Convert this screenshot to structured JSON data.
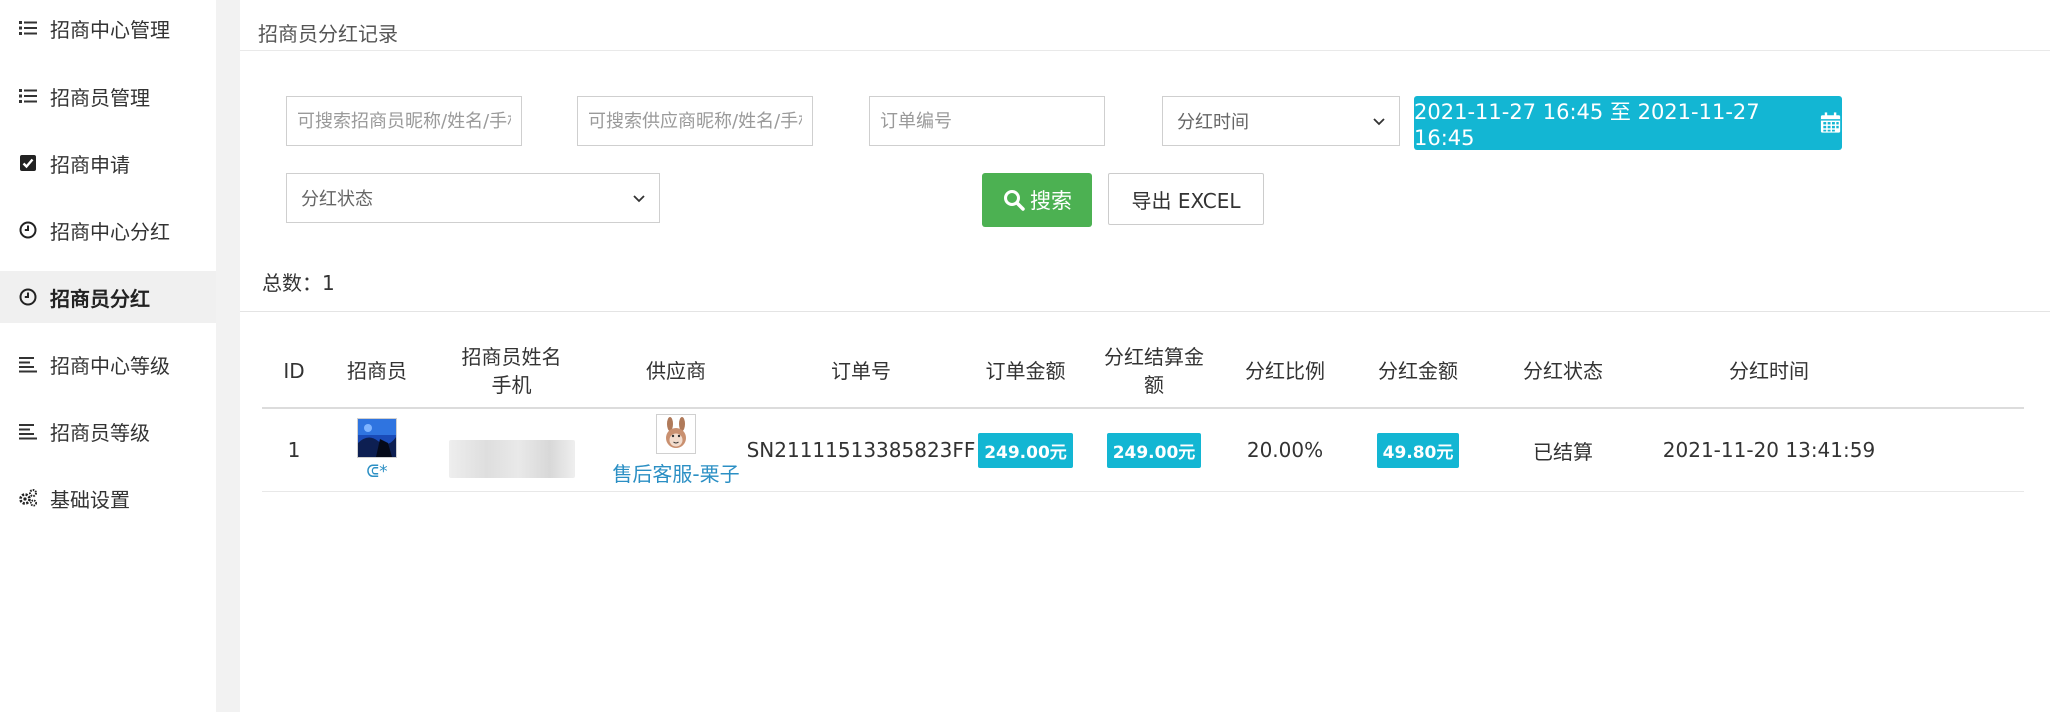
{
  "sidebar": {
    "items": [
      {
        "label": "招商中心管理",
        "icon": "list-icon"
      },
      {
        "label": "招商员管理",
        "icon": "list-icon"
      },
      {
        "label": "招商申请",
        "icon": "checkbox-icon"
      },
      {
        "label": "招商中心分红",
        "icon": "clock-icon"
      },
      {
        "label": "招商员分红",
        "icon": "clock-icon",
        "active": true
      },
      {
        "label": "招商中心等级",
        "icon": "align-left-icon"
      },
      {
        "label": "招商员等级",
        "icon": "align-left-icon"
      },
      {
        "label": "基础设置",
        "icon": "gears-icon"
      }
    ]
  },
  "page": {
    "title": "招商员分红记录"
  },
  "filters": {
    "recruiter_search_placeholder": "可搜索招商员昵称/姓名/手机",
    "supplier_search_placeholder": "可搜索供应商昵称/姓名/手机",
    "order_no_placeholder": "订单编号",
    "time_type_selected": "分红时间",
    "date_range": "2021-11-27 16:45 至 2021-11-27 16:45",
    "status_selected": "分红状态",
    "search_label": "搜索",
    "export_label": "导出 EXCEL"
  },
  "summary": {
    "total_label": "总数：",
    "total_value": "1"
  },
  "table": {
    "headers": {
      "id": "ID",
      "recruiter": "招商员",
      "name_line1": "招商员姓名",
      "name_line2": "手机",
      "supplier": "供应商",
      "order_no": "订单号",
      "order_amount": "订单金额",
      "settle_line1": "分红结算金",
      "settle_line2": "额",
      "ratio": "分红比例",
      "dividend": "分红金额",
      "status": "分红状态",
      "time": "分红时间"
    },
    "rows": [
      {
        "id": "1",
        "recruiter_nick": "ᕳ*",
        "supplier_name": "售后客服-栗子",
        "order_no": "SN21111513385823FF",
        "order_amount": "249.00元",
        "settle_amount": "249.00元",
        "ratio": "20.00%",
        "dividend": "49.80元",
        "status": "已结算",
        "time": "2021-11-20 13:41:59"
      }
    ]
  },
  "colors": {
    "accent": "#13b6d3",
    "search_button": "#4cb152",
    "link": "#2b8fc4"
  }
}
